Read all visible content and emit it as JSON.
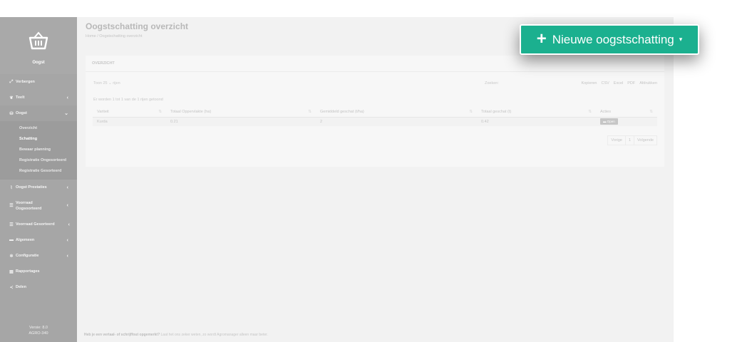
{
  "sidebar": {
    "logo_text": "Oogst",
    "items": [
      {
        "label": "Verbergen",
        "icon": "compress-icon",
        "chev": ""
      },
      {
        "label": "Teelt",
        "icon": "leaf-icon",
        "chev": "‹"
      },
      {
        "label": "Oogst",
        "icon": "basket-icon",
        "chev": "⌄"
      },
      {
        "label": "Oogst Prestaties",
        "icon": "chart-icon",
        "chev": "‹"
      },
      {
        "label": "Voorraad Oogsoorteerd",
        "icon": "list-icon",
        "chev": "‹"
      },
      {
        "label": "Voorraad Gesorteerd",
        "icon": "list-icon",
        "chev": "‹"
      },
      {
        "label": "Algemeen",
        "icon": "folder-icon",
        "chev": "‹"
      },
      {
        "label": "Configuratie",
        "icon": "gear-icon",
        "chev": "‹"
      },
      {
        "label": "Rapportages",
        "icon": "file-icon",
        "chev": ""
      },
      {
        "label": "Delen",
        "icon": "share-icon",
        "chev": ""
      }
    ],
    "sub_items": [
      "Overzicht",
      "Schatting",
      "Bewaar planning",
      "Registratie Ongesorteerd",
      "Registratie Gesorteerd"
    ],
    "version_line1": "Versie: 8.0",
    "version_line2": "AGRO-340"
  },
  "main": {
    "title": "Oogstschatting overzicht",
    "breadcrumb": "Home  /  Oogstschatting overzicht",
    "card_title": "OVERZICHT",
    "length_label": "Toon   25    ⌄  rijen",
    "search_label": "Zoeken:",
    "exports": [
      "Kopieren",
      "CSV",
      "Excel",
      "PDF",
      "Afdrukken"
    ],
    "info": "Er worden 1 tot 1 van de 1 rijen getoond",
    "columns": [
      "Variteit",
      "Totaal Oppervlakte (ha)",
      "Gemiddeld geschat (t/ha)",
      "Totaal geschat (t)",
      "Acties"
    ],
    "rows": [
      {
        "variety": "Kurda",
        "area": "0.21",
        "avg": "2",
        "total": "0.42",
        "action": "Open"
      }
    ],
    "pager": [
      "Vorige",
      "1",
      "Volgende"
    ],
    "footer_bold": "Heb je een vertaal- of schrijffout opgemerkt?",
    "footer_rest": " Laat het ons zeker weten, zo wordt Agromanager alleen maar beter."
  },
  "new_button": {
    "plus": "+",
    "label": "Nieuwe oogstschatting",
    "caret": "▾"
  },
  "colors": {
    "accent": "#1bb08f",
    "sidebar": "#a6a6a6"
  }
}
